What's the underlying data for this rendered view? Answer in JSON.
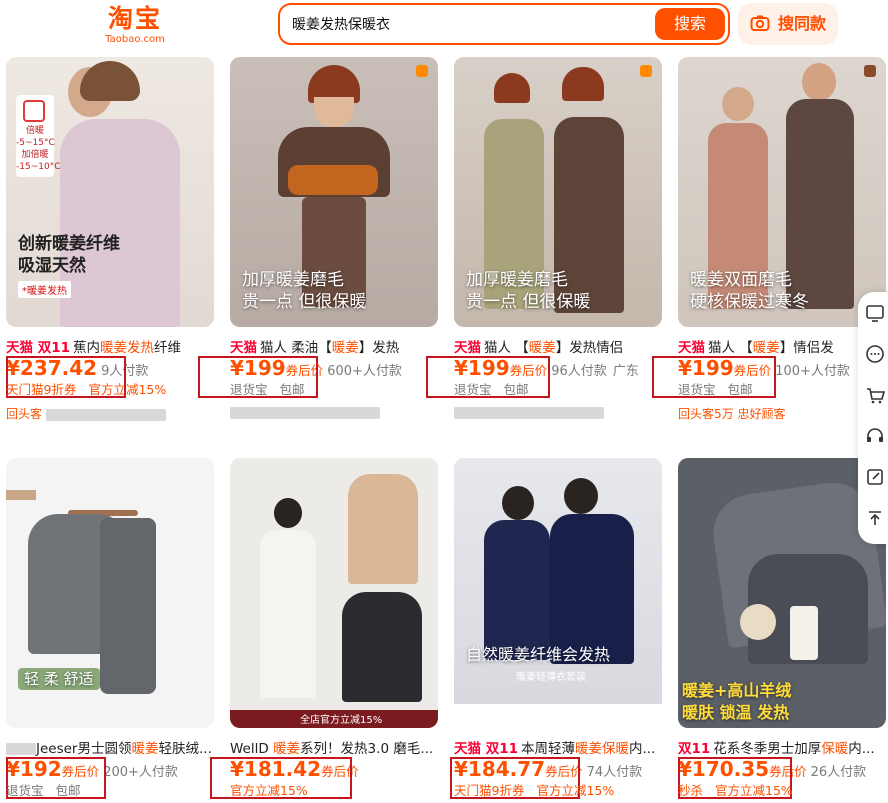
{
  "header": {
    "logo_cn": "淘宝",
    "logo_en": "Taobao.com",
    "search_value": "暖姜发热保暖衣",
    "search_button": "搜索",
    "image_search_button": "搜同款"
  },
  "products": [
    {
      "badge_top": "倍暖 -5~15°C",
      "badge_bottom": "加倍暖 -15~10°C",
      "caption": "创新暖姜纤维\n吸湿天然",
      "caption2": "*暖姜发热",
      "tag": "天猫 双11",
      "title_pre": "蕉内",
      "title_hl": "暖姜发热",
      "title_post": "纤维",
      "price": "¥237.42",
      "price_label": "",
      "sold": "9人付款",
      "location": "",
      "tag1": "天门猫9折券",
      "tag2": "官方立减15%",
      "row3": "回头客"
    },
    {
      "caption": "加厚暖姜磨毛\n贵一点 但很保暖",
      "tag": "天猫",
      "title_pre": "猫人 柔油【",
      "title_hl": "暖姜",
      "title_post": "】发热",
      "price": "¥199",
      "price_label": "券后价",
      "sold": "600+人付款",
      "location": "",
      "tag1": "退货宝",
      "tag2": "包邮",
      "row3": ""
    },
    {
      "caption": "加厚暖姜磨毛\n贵一点 但很保暖",
      "tag": "天猫",
      "title_pre": "猫人 【",
      "title_hl": "暖姜",
      "title_post": "】发热情侣",
      "price": "¥199",
      "price_label": "券后价",
      "sold": "96人付款",
      "location": "广东",
      "tag1": "退货宝",
      "tag2": "包邮",
      "row3": ""
    },
    {
      "caption": "暖姜双面磨毛\n硬核保暖过寒冬",
      "tag": "天猫",
      "title_pre": "猫人 【",
      "title_hl": "暖姜",
      "title_post": "】情侣发",
      "price": "¥199",
      "price_label": "券后价",
      "sold": "100+人付款",
      "location": "",
      "tag1": "退货宝",
      "tag2": "包邮",
      "row3": "回头客5万 忠好顾客"
    },
    {
      "caption": "轻 柔 舒适",
      "tag": "",
      "title_pre": "Jeeser男士圆领",
      "title_hl": "暖姜",
      "title_post": "轻肤绒...",
      "price": "¥192",
      "price_label": "券后价",
      "sold": "200+人付款",
      "location": "",
      "tag1": "退货宝",
      "tag2": "包邮",
      "row3": ""
    },
    {
      "caption": "全店官方立减15%",
      "tag": "",
      "title_pre": "WellD ",
      "title_hl": "暖姜",
      "title_post": "系列！发热3.0 磨毛...",
      "price": "¥181.42",
      "price_label": "券后价",
      "sold": "",
      "location": "",
      "tag1": "官方立减15%",
      "tag2": "",
      "row3": ""
    },
    {
      "caption": "自然暖姜纤维会发热",
      "caption2": "暖姜轻薄衣套装",
      "tag": "天猫 双11",
      "title_pre": "本周轻薄",
      "title_hl": "暖姜保暖",
      "title_post": "内...",
      "price": "¥184.77",
      "price_label": "券后价",
      "sold": "74人付款",
      "location": "",
      "tag1": "天门猫9折券",
      "tag2": "官方立减15%",
      "row3": ""
    },
    {
      "caption": "暖姜+高山羊绒\n暖肤 锁温 发热",
      "tag": "双11",
      "title_pre": "花系冬季男士加厚",
      "title_hl": "保暖",
      "title_post": "内...",
      "price": "¥170.35",
      "price_label": "券后价",
      "sold": "26人付款",
      "location": "",
      "tag1": "秒杀",
      "tag2": "官方立减15%",
      "row3": ""
    }
  ],
  "sidebar": [
    "feedback-icon",
    "message-icon",
    "cart-icon",
    "service-icon",
    "edit-icon",
    "back-to-top-icon"
  ],
  "colors": {
    "brand": "#ff5000",
    "tmall": "#ff0036",
    "highlight_box": "#c4161c"
  }
}
